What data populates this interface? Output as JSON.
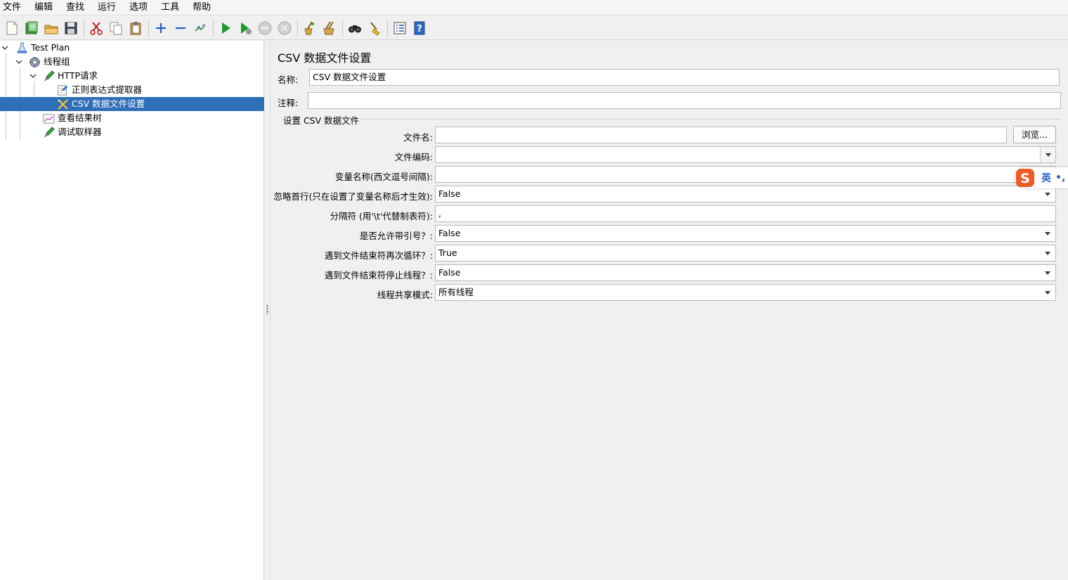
{
  "menu": [
    "文件",
    "编辑",
    "查找",
    "运行",
    "选项",
    "工具",
    "帮助"
  ],
  "toolbar": {
    "buttons": [
      "new-icon",
      "templates-icon",
      "open-icon",
      "save-icon",
      "cut-icon",
      "copy-icon",
      "paste-icon",
      "expand-icon",
      "collapse-icon",
      "toggle-icon",
      "start-icon",
      "start-no-pause-icon",
      "stop-icon",
      "shutdown-icon",
      "clear-icon",
      "clear-all-icon",
      "search-icon",
      "reset-search-icon",
      "function-helper-icon",
      "help-icon"
    ]
  },
  "tree": {
    "items": [
      {
        "label": "Test Plan",
        "icon": "test-plan-icon"
      },
      {
        "label": "线程组",
        "icon": "thread-group-icon"
      },
      {
        "label": "HTTP请求",
        "icon": "sampler-icon"
      },
      {
        "label": "正则表达式提取器",
        "icon": "extractor-icon"
      },
      {
        "label": "CSV 数据文件设置",
        "icon": "config-icon"
      },
      {
        "label": "查看结果树",
        "icon": "listener-icon"
      },
      {
        "label": "调试取样器",
        "icon": "debug-sampler-icon"
      }
    ]
  },
  "panel": {
    "title": "CSV 数据文件设置",
    "name_label": "名称:",
    "name_value": "CSV 数据文件设置",
    "comment_label": "注释:",
    "comment_value": "",
    "group_title": "设置 CSV 数据文件",
    "fields": {
      "filename_label": "文件名:",
      "filename_value": "",
      "browse_label": "浏览...",
      "encoding_label": "文件编码:",
      "encoding_value": "",
      "varnames_label": "变量名称(西文逗号间隔):",
      "varnames_value": "",
      "ignore_first_label": "忽略首行(只在设置了变量名称后才生效):",
      "ignore_first_value": "False",
      "delimiter_label": "分隔符 (用'\\t'代替制表符):",
      "delimiter_value": ",",
      "quoted_label": "是否允许带引号？:",
      "quoted_value": "False",
      "recycle_label": "遇到文件结束符再次循环？:",
      "recycle_value": "True",
      "stop_thread_label": "遇到文件结束符停止线程？:",
      "stop_thread_value": "False",
      "sharing_label": "线程共享模式:",
      "sharing_value": "所有线程"
    }
  },
  "ime": {
    "logo": "S",
    "lang": "英",
    "dots": "•,"
  },
  "colors": {
    "selection": "#2f6fb8",
    "ime_logo": "#f05a24",
    "ime_text": "#2a62c9"
  }
}
